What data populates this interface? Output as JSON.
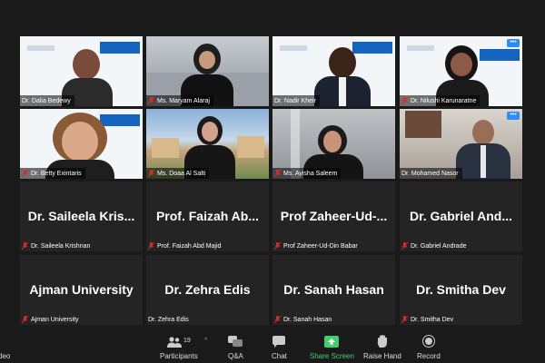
{
  "gallery": {
    "row1": [
      {
        "name": "Dr. Dalia Bedewy",
        "muted": false
      },
      {
        "name": "Ms. Maryam Alaraj",
        "muted": true
      },
      {
        "name": "Dr. Nadir Kheir",
        "muted": false
      },
      {
        "name": "Dr. Nilushi Karunaratne",
        "muted": true
      }
    ],
    "row2": [
      {
        "name": "Dr. Betty Exintaris",
        "muted": true
      },
      {
        "name": "Ms. Doaa Al Salti",
        "muted": true
      },
      {
        "name": "Ms. Ayisha Saleem",
        "muted": true
      },
      {
        "name": "Dr. Mohamed Nasor",
        "muted": false
      }
    ],
    "row3": [
      {
        "big": "Dr. Saileela Kris...",
        "name": "Dr. Saileela Krishnan",
        "muted": true
      },
      {
        "big": "Prof. Faizah Ab...",
        "name": "Prof. Faizah Abd Majid",
        "muted": true
      },
      {
        "big": "Prof Zaheer-Ud-...",
        "name": "Prof Zaheer-Ud-Din Babar",
        "muted": true
      },
      {
        "big": "Dr. Gabriel And...",
        "name": "Dr. Gabriel Andrade",
        "muted": true
      }
    ],
    "row4": [
      {
        "big": "Ajman University",
        "name": "Ajman University",
        "muted": true
      },
      {
        "big": "Dr. Zehra Edis",
        "name": "Dr. Zehra Edis",
        "muted": false
      },
      {
        "big": "Dr. Sanah Hasan",
        "name": "Dr. Sanah Hasan",
        "muted": true
      },
      {
        "big": "Dr. Smitha Dev",
        "name": "Dr. Smitha Dev",
        "muted": true
      }
    ],
    "more_label": "•••"
  },
  "toolbar": {
    "video_label": "deo",
    "participants_label": "Participants",
    "participants_count": "19",
    "qa_label": "Q&A",
    "chat_label": "Chat",
    "share_label": "Share Screen",
    "raise_label": "Raise Hand",
    "record_label": "Record"
  },
  "colors": {
    "active_speaker": "#d8e33a",
    "share_green": "#3fd06b",
    "muted_red": "#e02828",
    "menu_blue": "#2d8cff"
  }
}
